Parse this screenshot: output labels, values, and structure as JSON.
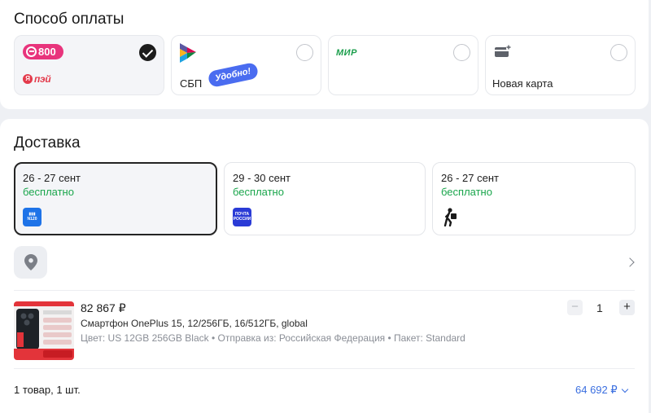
{
  "payment": {
    "title": "Способ оплаты",
    "options": [
      {
        "id": "800-yapay",
        "logo_text": "800",
        "logo2_text": "пэй",
        "selected": true
      },
      {
        "id": "sbp",
        "label": "СБП",
        "badge": "Удобно!",
        "selected": false
      },
      {
        "id": "mir",
        "logo_text": "МИР",
        "selected": false
      },
      {
        "id": "new-card",
        "label": "Новая карта",
        "selected": false
      }
    ]
  },
  "delivery": {
    "title": "Доставка",
    "options": [
      {
        "dates": "26 - 27 сент",
        "price": "бесплатно",
        "carrier_icon": "boxberry-icon",
        "selected": true
      },
      {
        "dates": "29 - 30 сент",
        "price": "бесплатно",
        "carrier_icon": "russian-post-icon",
        "selected": false
      },
      {
        "dates": "26 - 27 сент",
        "price": "бесплатно",
        "carrier_icon": "courier-icon",
        "selected": false
      }
    ]
  },
  "product": {
    "price": "82 867 ₽",
    "name": "Смартфон OnePlus 15, 12/256ГБ, 16/512ГБ, global",
    "attributes": "Цвет: US 12GB 256GB Black • Отправка из: Российская Федерация • Пакет: Standard",
    "quantity": "1",
    "minus": "−",
    "plus": "+"
  },
  "summary": {
    "items": "1 товар, 1 шт.",
    "total": "64 692 ₽"
  },
  "colors": {
    "accent_green": "#1aa64c",
    "link_blue": "#3b6fe0",
    "badge_blue": "#4a6cf0",
    "brand_pink": "#e8347c"
  }
}
